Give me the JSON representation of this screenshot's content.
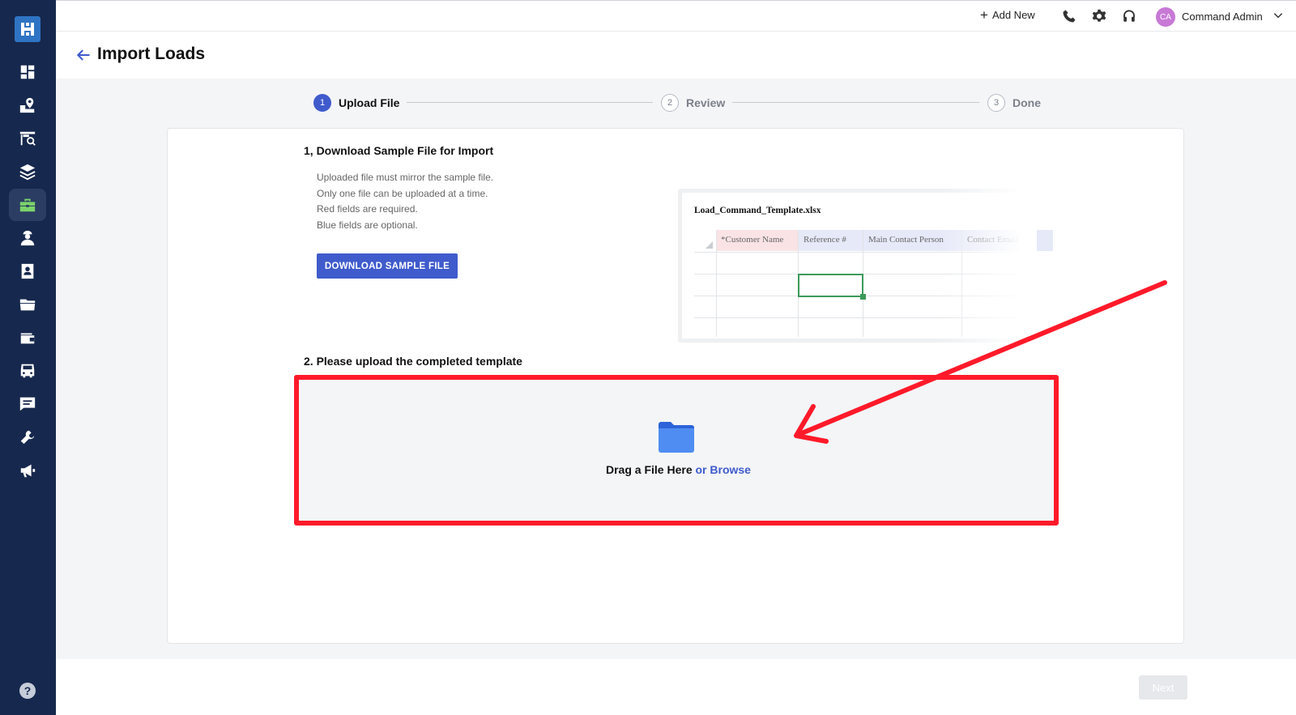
{
  "app": {
    "brand_color": "#2f74c4",
    "sidebar_color": "#16284d",
    "accent": "#3f5bcc"
  },
  "sidebar": {
    "items": [
      {
        "icon": "dashboard-icon",
        "active": false
      },
      {
        "icon": "map-loads-icon",
        "active": false
      },
      {
        "icon": "search-loads-icon",
        "active": false
      },
      {
        "icon": "layers-icon",
        "active": false
      },
      {
        "icon": "briefcase-icon",
        "active": true
      },
      {
        "icon": "driver-icon",
        "active": false
      },
      {
        "icon": "contact-card-icon",
        "active": false
      },
      {
        "icon": "folder-icon",
        "active": false
      },
      {
        "icon": "wallet-icon",
        "active": false
      },
      {
        "icon": "truck-icon",
        "active": false
      },
      {
        "icon": "message-icon",
        "active": false
      },
      {
        "icon": "wrench-icon",
        "active": false
      },
      {
        "icon": "megaphone-icon",
        "active": false
      }
    ],
    "help_label": "?"
  },
  "topbar": {
    "add_new_label": "Add New",
    "user_initials": "CA",
    "user_name": "Command Admin"
  },
  "header": {
    "title": "Import Loads"
  },
  "stepper": {
    "steps": [
      {
        "number": "1",
        "label": "Upload File",
        "active": true
      },
      {
        "number": "2",
        "label": "Review",
        "active": false
      },
      {
        "number": "3",
        "label": "Done",
        "active": false
      }
    ]
  },
  "section1": {
    "title": "1, Download Sample File for Import",
    "hints": [
      "Uploaded file must mirror the sample file.",
      "Only one file can be uploaded at a time.",
      "Red fields are required.",
      "Blue fields are optional."
    ],
    "download_button": "DOWNLOAD SAMPLE FILE"
  },
  "template_preview": {
    "file_name": "Load_Command_Template.xlsx",
    "columns": [
      "*Customer Name",
      "Reference #",
      "Main Contact Person",
      "Contact Email"
    ]
  },
  "section2": {
    "title": "2. Please upload the completed template",
    "drop_text": "Drag a File Here",
    "browse_text": "or Browse"
  },
  "footer": {
    "next_label": "Next"
  }
}
